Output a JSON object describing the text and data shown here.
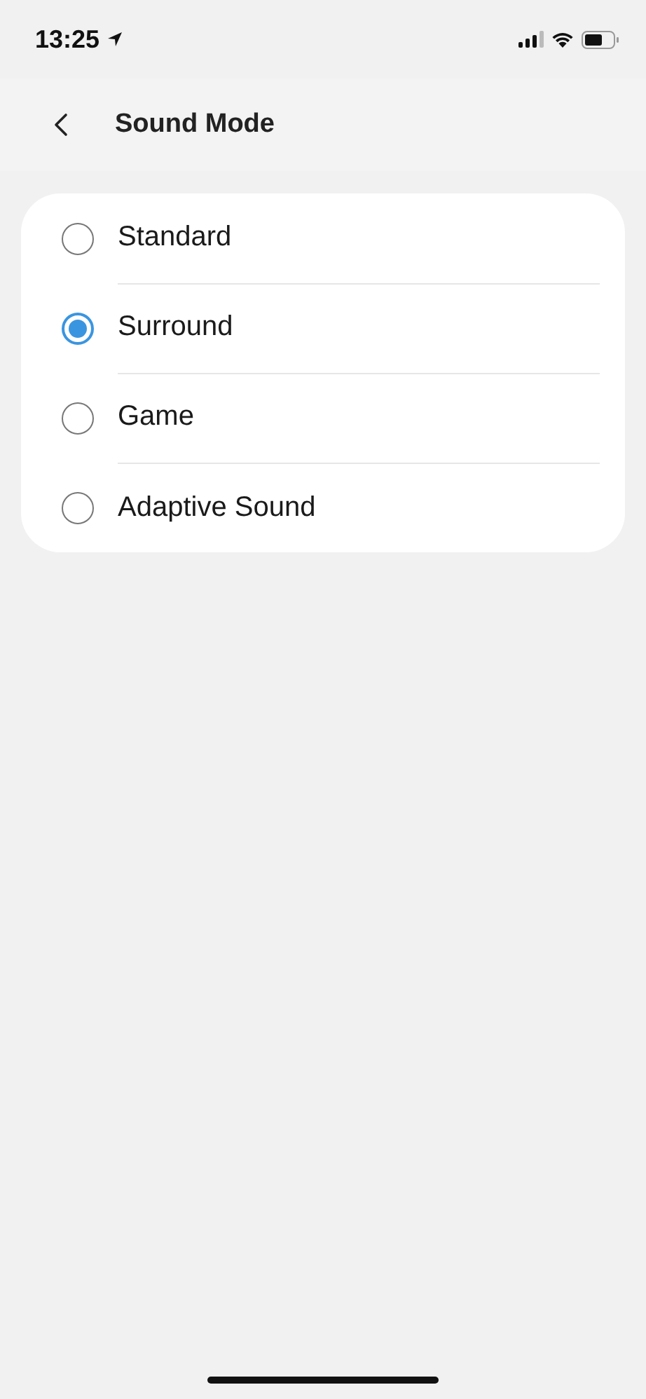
{
  "status_bar": {
    "time": "13:25"
  },
  "header": {
    "title": "Sound Mode"
  },
  "options": [
    {
      "label": "Standard",
      "selected": false
    },
    {
      "label": "Surround",
      "selected": true
    },
    {
      "label": "Game",
      "selected": false
    },
    {
      "label": "Adaptive Sound",
      "selected": false
    }
  ]
}
